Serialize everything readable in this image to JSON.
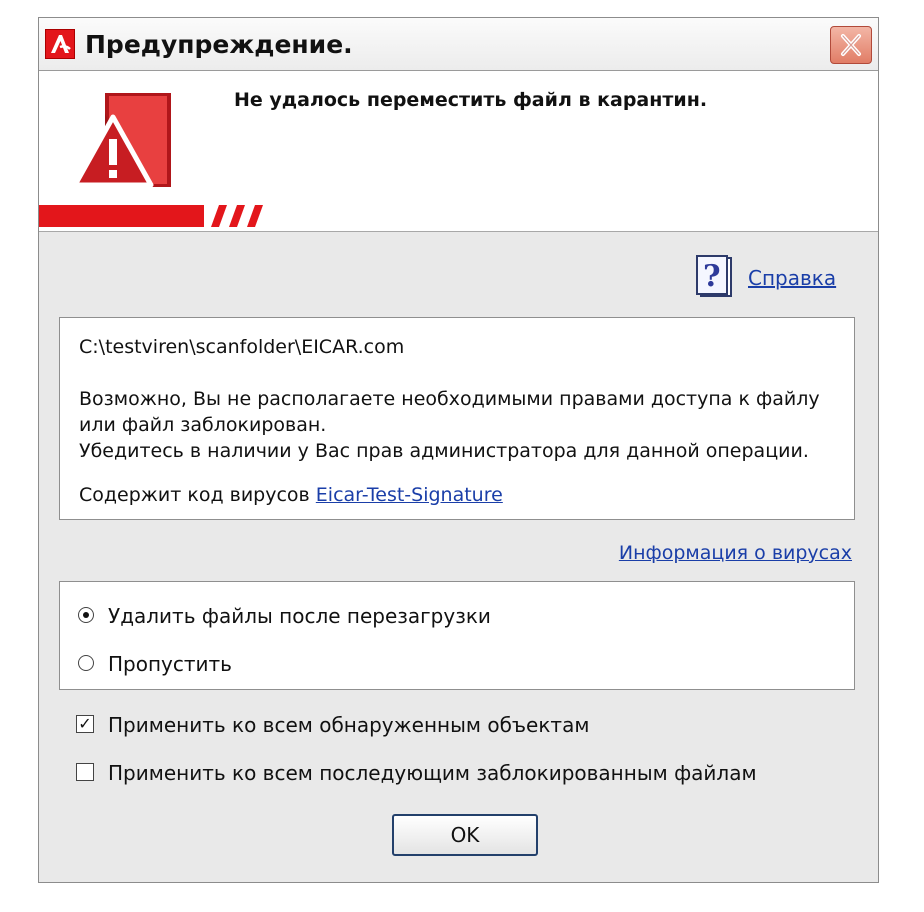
{
  "dialog": {
    "title": "Предупреждение.",
    "banner_message": "Не удалось переместить файл в карантин."
  },
  "help_link": "Справка",
  "info": {
    "file_path": "C:\\testviren\\scanfolder\\EICAR.com",
    "reason_line1": "Возможно, Вы не располагаете необходимыми правами доступа к файлу",
    "reason_line2": "или файл заблокирован.",
    "reason_line3": "Убедитесь в наличии у Вас прав администратора для данной операции.",
    "virus_prefix": "Содержит код вирусов",
    "virus_name": "Eicar-Test-Signature"
  },
  "virus_info_link": "Информация о вирусах",
  "options": [
    {
      "label": "Удалить файлы после перезагрузки",
      "selected": true
    },
    {
      "label": "Пропустить",
      "selected": false
    }
  ],
  "checkboxes": [
    {
      "label": "Применить ко всем обнаруженным объектам",
      "checked": true
    },
    {
      "label": "Применить ко всем последующим заблокированным файлам",
      "checked": false
    }
  ],
  "ok_button": "OK",
  "colors": {
    "accent": "#e3161b",
    "link": "#1a3ea8",
    "dialog_bg": "#e9e9e9"
  },
  "icons": [
    "avira-logo-icon",
    "close-icon",
    "warning-icon",
    "help-icon",
    "radio-selected-icon",
    "checkbox-checked-icon"
  ]
}
